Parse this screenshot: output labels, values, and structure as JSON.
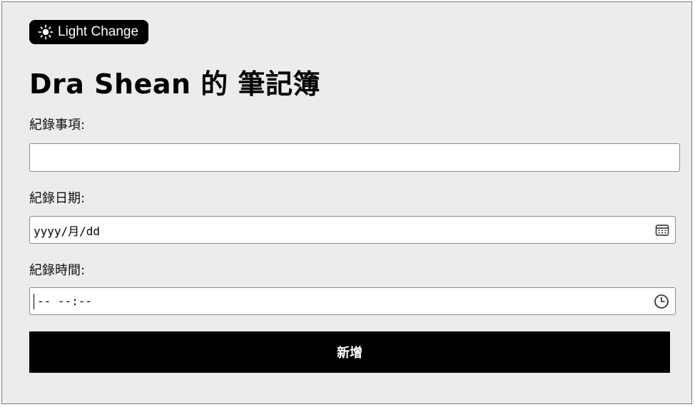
{
  "theme_toggle": {
    "label": "Light Change",
    "icon": "sun-icon"
  },
  "page": {
    "title": "Dra Shean 的 筆記簿"
  },
  "form": {
    "item": {
      "label": "紀錄事項:",
      "value": ""
    },
    "date": {
      "label": "紀錄日期:",
      "placeholder": "yyyy/月/dd",
      "icon": "calendar-icon"
    },
    "time": {
      "label": "紀錄時間:",
      "placeholder": "-- --:--",
      "icon": "clock-icon"
    },
    "submit_label": "新增"
  },
  "colors": {
    "background": "#ececec",
    "button": "#000000",
    "button_text": "#ffffff"
  }
}
